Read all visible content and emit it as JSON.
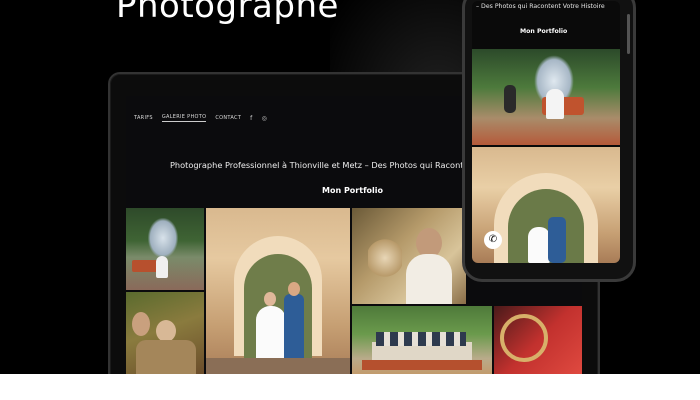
{
  "hero": {
    "title": "Photographe"
  },
  "laptop": {
    "nav": {
      "tarifs": "TARIFS",
      "galerie": "GALERIE PHOTO",
      "contact": "CONTACT"
    },
    "subtitle": "Photographe Professionnel à Thionville et Metz – Des Photos qui Raconten",
    "heading": "Mon Portfolio"
  },
  "phone": {
    "subtitle": "– Des Photos qui Racontent Votre Histoire",
    "heading": "Mon Portfolio"
  },
  "icons": {
    "facebook": "facebook-icon",
    "instagram": "instagram-icon",
    "phone": "phone-icon"
  },
  "colors": {
    "background": "#000000",
    "text": "#ffffff"
  }
}
